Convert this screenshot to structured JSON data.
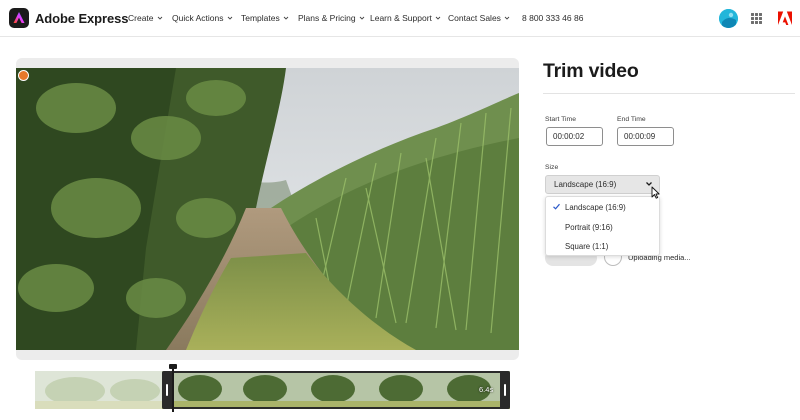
{
  "brand": {
    "name": "Adobe Express"
  },
  "nav": {
    "items": [
      {
        "label": "Create"
      },
      {
        "label": "Quick Actions"
      },
      {
        "label": "Templates"
      },
      {
        "label": "Plans & Pricing"
      },
      {
        "label": "Learn & Support"
      },
      {
        "label": "Contact Sales"
      }
    ],
    "phone": "8 800 333 46 86"
  },
  "icons": {
    "brand": "adobe-express-logo-icon",
    "avatar": "user-avatar",
    "apps": "apps-grid-icon",
    "adobe": "adobe-logo-icon",
    "chevron": "chevron-down-icon",
    "check": "checkmark-icon",
    "spinner": "loading-spinner-icon"
  },
  "colors": {
    "accent_avatar": "#1fb4d8",
    "adobe_red": "#eb1000",
    "badge_orange": "#e7782a",
    "timeline_handle": "#2a2a2a"
  },
  "panel": {
    "title": "Trim video",
    "start_time": {
      "label": "Start Time",
      "value": "00:00:02"
    },
    "end_time": {
      "label": "End Time",
      "value": "00:00:09"
    },
    "size": {
      "label": "Size",
      "selected": "Landscape (16:9)",
      "options": [
        {
          "label": "Landscape (16:9)",
          "checked": true
        },
        {
          "label": "Portrait (9:16)",
          "checked": false
        },
        {
          "label": "Square (1:1)",
          "checked": false
        }
      ]
    },
    "status": "Uploading media..."
  },
  "timeline": {
    "duration": "6.4s"
  }
}
